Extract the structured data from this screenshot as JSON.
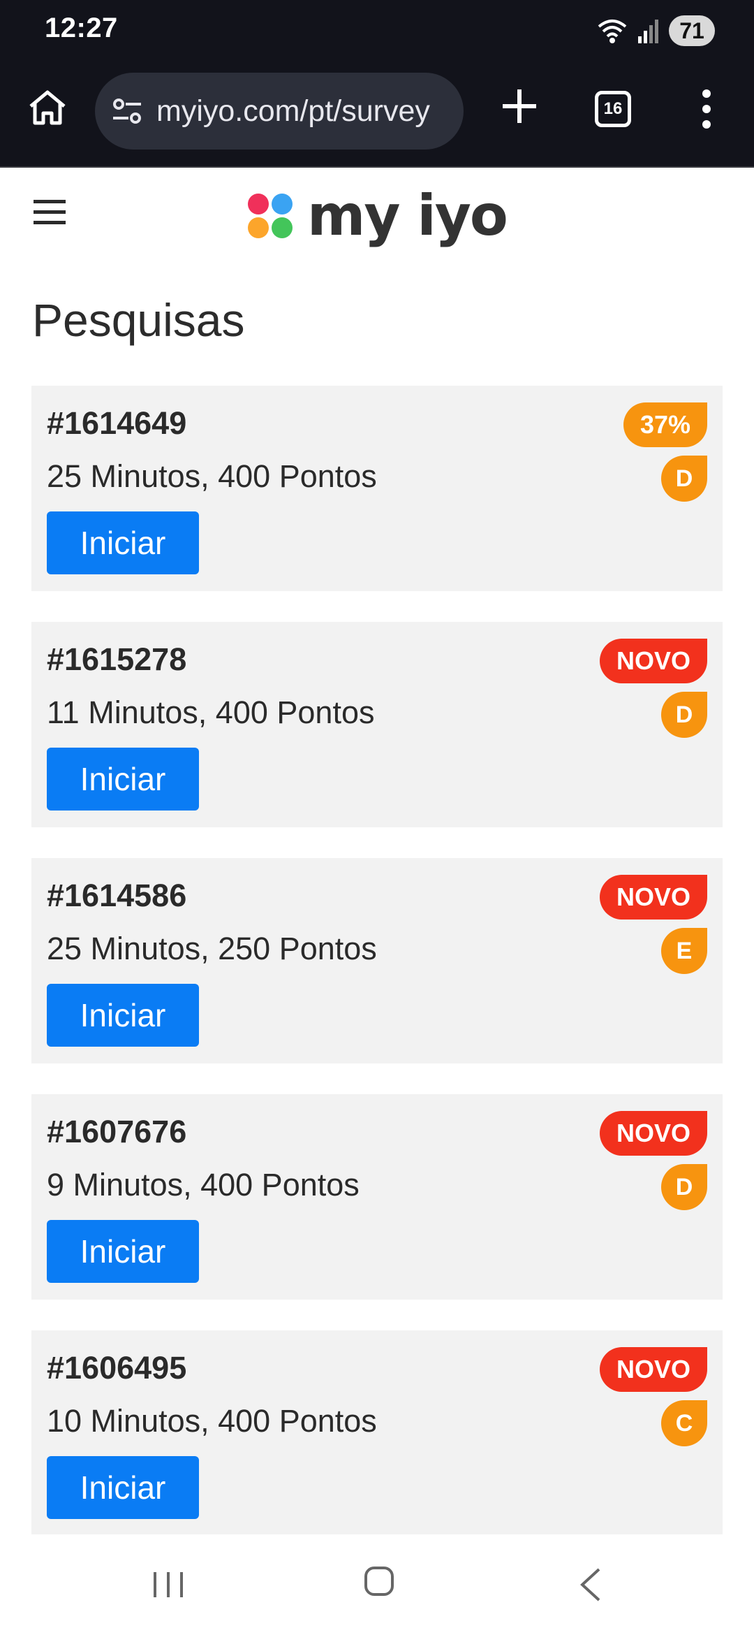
{
  "status_bar": {
    "time": "12:27",
    "battery": "71",
    "icons": [
      "wifi-icon",
      "signal-icon"
    ]
  },
  "browser": {
    "url": "myiyo.com/pt/survey",
    "tab_count": "16",
    "icons": [
      "home-icon",
      "site-settings-icon",
      "plus-icon",
      "more-vert-icon"
    ]
  },
  "site": {
    "logo_text": "my iyo",
    "page_title": "Pesquisas",
    "colors": {
      "start_button": "#0a7cf4",
      "new_badge": "#f2311d",
      "progress_badge": "#f7940f",
      "grade_badge": "#f7940f",
      "card_background": "#f2f2f2"
    }
  },
  "surveys": [
    {
      "id": "#1614649",
      "meta": "25 Minutos, 400 Pontos",
      "status": "37%",
      "status_type": "progress",
      "grade": "D",
      "button": "Iniciar"
    },
    {
      "id": "#1615278",
      "meta": "11 Minutos, 400 Pontos",
      "status": "NOVO",
      "status_type": "new",
      "grade": "D",
      "button": "Iniciar"
    },
    {
      "id": "#1614586",
      "meta": "25 Minutos, 250 Pontos",
      "status": "NOVO",
      "status_type": "new",
      "grade": "E",
      "button": "Iniciar"
    },
    {
      "id": "#1607676",
      "meta": "9 Minutos, 400 Pontos",
      "status": "NOVO",
      "status_type": "new",
      "grade": "D",
      "button": "Iniciar"
    },
    {
      "id": "#1606495",
      "meta": "10 Minutos, 400 Pontos",
      "status": "NOVO",
      "status_type": "new",
      "grade": "C",
      "button": "Iniciar"
    }
  ],
  "nav_bar": {
    "icons": [
      "recent-apps-icon",
      "home-circle-icon",
      "back-icon"
    ]
  }
}
